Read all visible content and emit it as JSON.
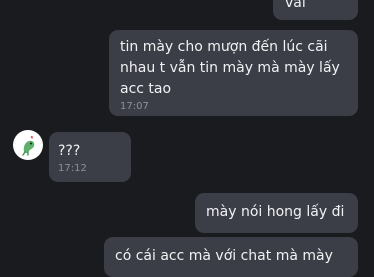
{
  "messages": [
    {
      "sender": "me",
      "text": "vải"
    },
    {
      "sender": "me",
      "text": "tin mày cho mượn đến lúc cãi nhau t vẫn tin mày mà mày lấy acc tao",
      "time": "17:07"
    },
    {
      "sender": "other",
      "text": "???",
      "time": "17:12"
    },
    {
      "sender": "me",
      "text": "mày nói hong lấy đi"
    },
    {
      "sender": "me",
      "text": "có cái acc mà với chat mà mày"
    }
  ],
  "contact": {
    "avatar_icon": "dinosaur-sticker-icon"
  },
  "colors": {
    "background": "#1a1b1f",
    "bubble": "#3b3e46",
    "text": "#f1f2f4",
    "time": "#8c9099"
  }
}
